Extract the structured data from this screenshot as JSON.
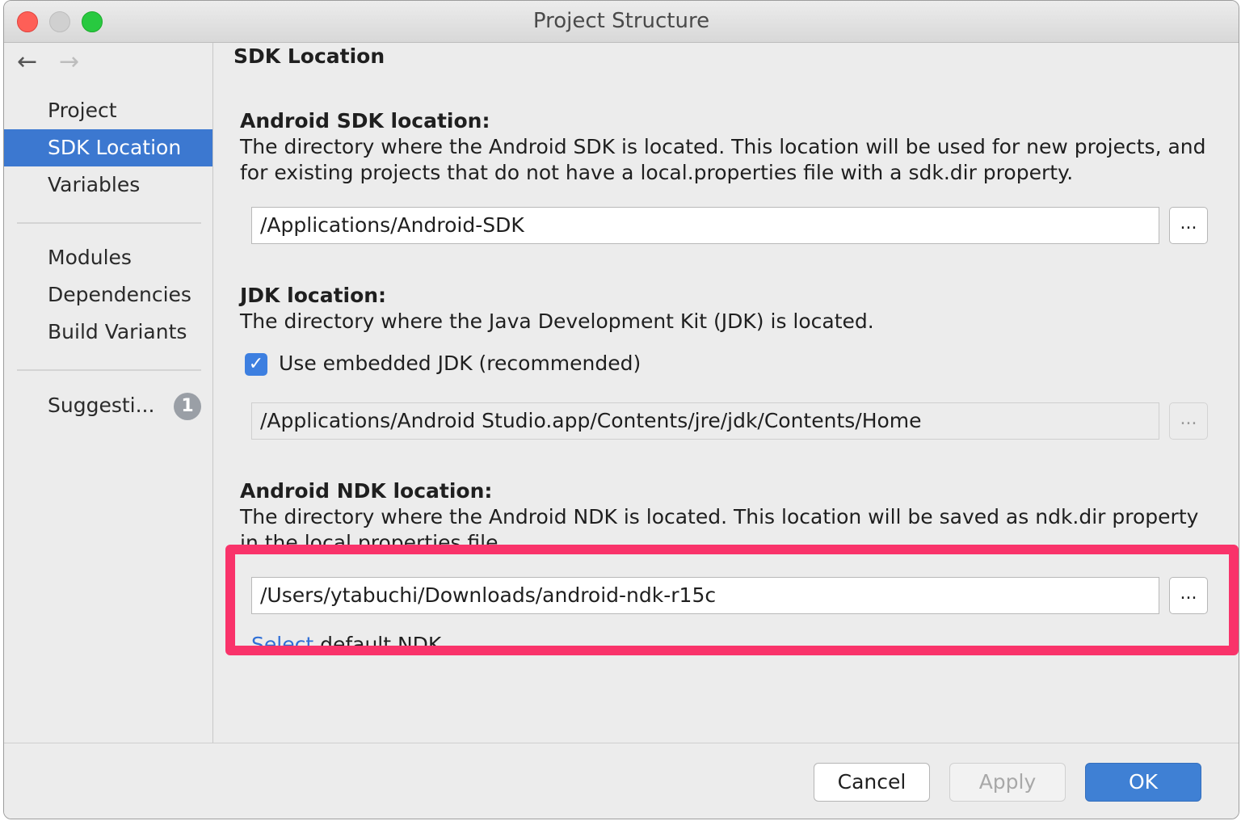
{
  "window": {
    "title": "Project Structure"
  },
  "nav": {
    "back_icon": "arrow-left-icon",
    "forward_icon": "arrow-right-icon"
  },
  "sidebar": {
    "items": [
      {
        "label": "Project"
      },
      {
        "label": "SDK Location",
        "selected": true
      },
      {
        "label": "Variables"
      },
      {
        "label": "Modules"
      },
      {
        "label": "Dependencies"
      },
      {
        "label": "Build Variants"
      },
      {
        "label": "Suggesti...",
        "badge": "1"
      }
    ]
  },
  "main": {
    "title": "SDK Location",
    "sdk": {
      "heading": "Android SDK location:",
      "description": "The directory where the Android SDK is located. This location will be used for new projects, and for existing projects that do not have a local.properties file with a sdk.dir property.",
      "path": "/Applications/Android-SDK",
      "browse_label": "..."
    },
    "jdk": {
      "heading": "JDK location:",
      "description": "The directory where the Java Development Kit (JDK) is located.",
      "checkbox_label": "Use embedded JDK (recommended)",
      "checked": true,
      "path": "/Applications/Android Studio.app/Contents/jre/jdk/Contents/Home",
      "browse_label": "..."
    },
    "ndk": {
      "heading": "Android NDK location:",
      "description": "The directory where the Android NDK is located. This location will be saved as ndk.dir property in the local.properties file.",
      "path": "/Users/ytabuchi/Downloads/android-ndk-r15c",
      "browse_label": "...",
      "link_label": "Select",
      "link_suffix": " default NDK"
    }
  },
  "footer": {
    "cancel_label": "Cancel",
    "apply_label": "Apply",
    "ok_label": "OK"
  },
  "colors": {
    "selection": "#3c78d0",
    "highlight": "#f9336a",
    "ok_button": "#3f80d4"
  }
}
